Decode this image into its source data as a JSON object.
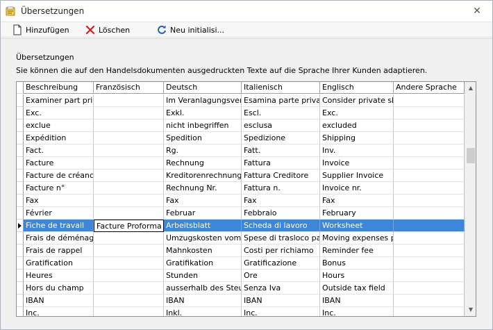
{
  "window": {
    "title": "Übersetzungen"
  },
  "toolbar": {
    "add": "Hinzufügen",
    "delete": "Löschen",
    "reinit": "Neu initialisi..."
  },
  "panel": {
    "heading": "Übersetzungen",
    "description": "Sie können die auf den Handelsdokumenten ausgedruckten Texte auf die Sprache Ihrer Kunden adaptieren."
  },
  "table": {
    "columns": [
      "Beschreibung",
      "Französisch",
      "Deutsch",
      "Italienisch",
      "Englisch",
      "Andere Sprache"
    ],
    "rows": [
      [
        "Examiner part privée",
        "",
        "Im Veranlagungsverfahren",
        "Esamina parte privata d",
        "Consider private share",
        ""
      ],
      [
        "Exc.",
        "",
        "Exkl.",
        "Escl.",
        "Exc.",
        ""
      ],
      [
        "exclue",
        "",
        "nicht inbegriffen",
        "esclusa",
        "excluded",
        ""
      ],
      [
        "Expédition",
        "",
        "Spedition",
        "Spedizione",
        "Shipping",
        ""
      ],
      [
        "Fact.",
        "",
        "Rg.",
        "Fatt.",
        "Inv.",
        ""
      ],
      [
        "Facture",
        "",
        "Rechnung",
        "Fattura",
        "Invoice",
        ""
      ],
      [
        "Facture de créancier",
        "",
        "Kreditorenrechnung",
        "Fattura Creditore",
        "Supplier Invoice",
        ""
      ],
      [
        "Facture n°",
        "",
        "Rechnung Nr.",
        "Fattura n.",
        "Invoice nr.",
        ""
      ],
      [
        "Fax",
        "",
        "Fax",
        "Fax",
        "Fax",
        ""
      ],
      [
        "Février",
        "",
        "Februar",
        "Febbraio",
        "February",
        ""
      ],
      [
        "Fiche de travail",
        "Facture Proforma",
        "Arbeitsblatt",
        "Scheda di lavoro",
        "Worksheet",
        ""
      ],
      [
        "Frais de déménagement",
        "",
        "Umzugskosten vom Arbeitgeber",
        "Spese di trasloco pagate",
        "Moving expenses paid",
        ""
      ],
      [
        "Frais de rappel",
        "",
        "Mahnkosten",
        "Costi per richiamo",
        "Reminder fee",
        ""
      ],
      [
        "Gratification",
        "",
        "Gratifikation",
        "Gratificazione",
        "Bonus",
        ""
      ],
      [
        "Heures",
        "",
        "Stunden",
        "Ore",
        "Hours",
        ""
      ],
      [
        "Hors du champ",
        "",
        "ausserhalb des Steuerfeldes",
        "Senza Iva",
        "Outside tax field",
        ""
      ],
      [
        "IBAN",
        "",
        "IBAN",
        "IBAN",
        "IBAN",
        ""
      ],
      [
        "Inc.",
        "",
        "Inkl.",
        "Inc.",
        "Inc.",
        ""
      ]
    ],
    "selected_row": 10
  },
  "colors": {
    "selection": "#3d86d8",
    "delete_icon": "#d11a1a",
    "reinit_icon": "#1f5fbf"
  }
}
